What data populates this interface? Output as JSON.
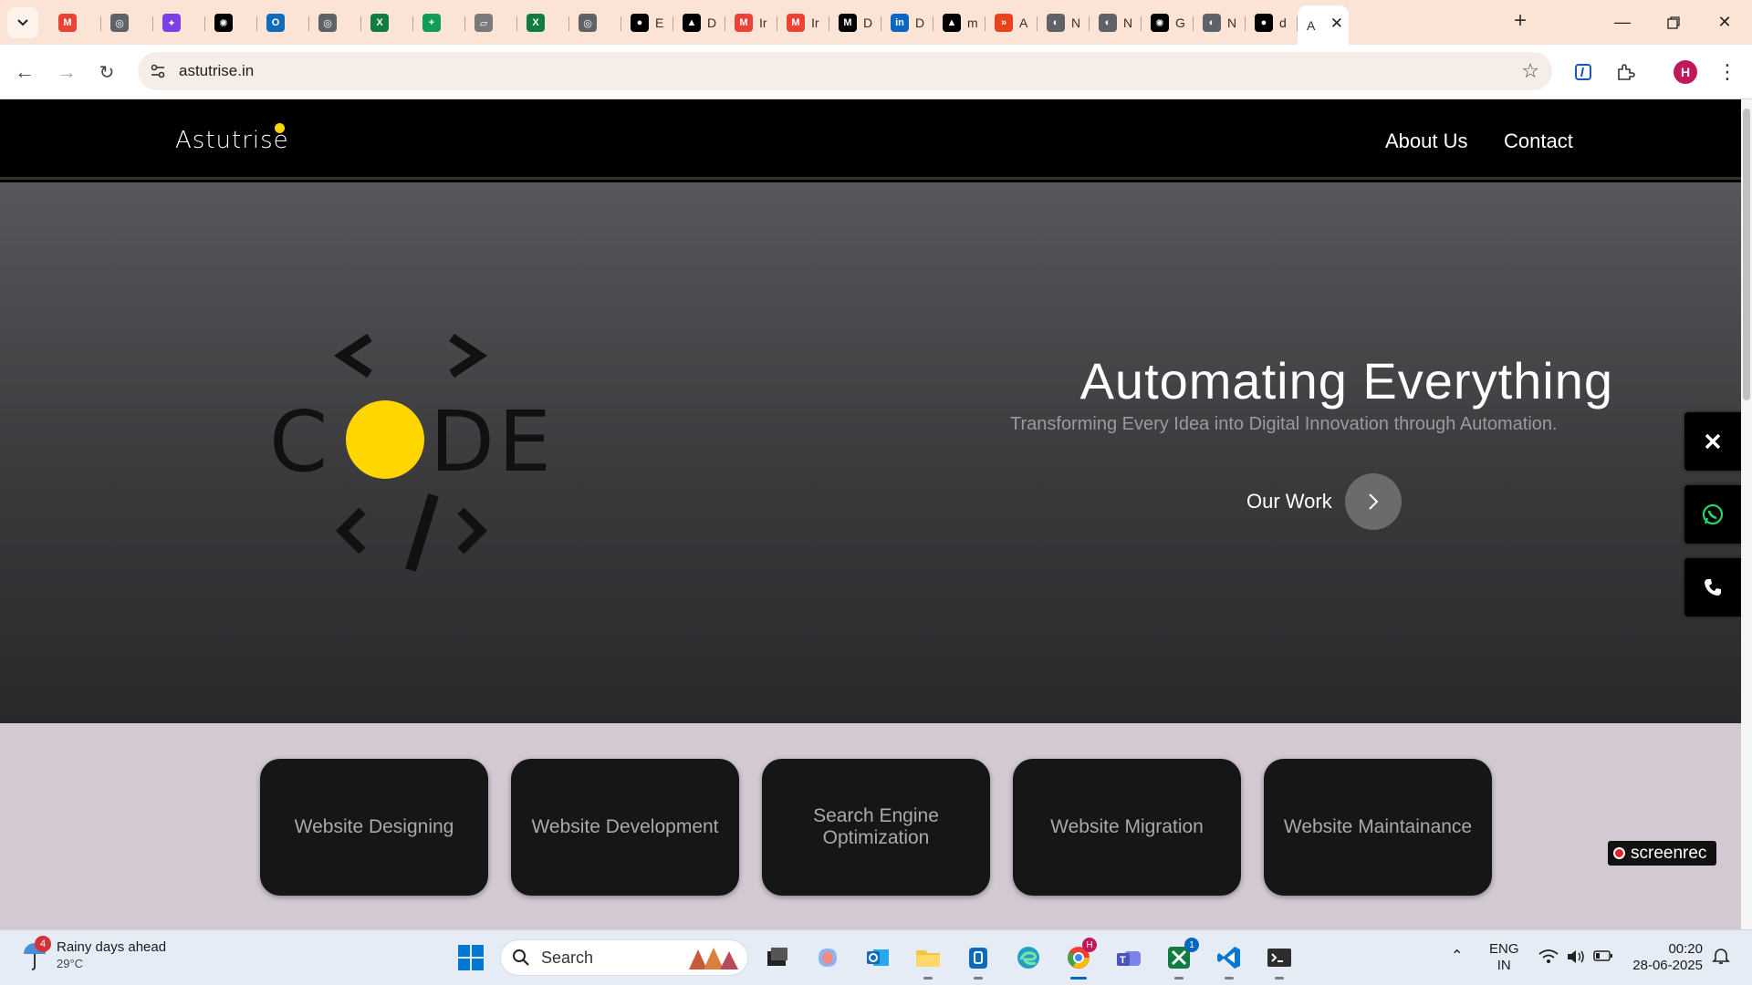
{
  "browser": {
    "tabs": [
      {
        "icon": "gmail-icon",
        "label": "",
        "color": "#ea4335"
      },
      {
        "icon": "globe-icon",
        "label": "",
        "color": "#5f6368"
      },
      {
        "icon": "copilot-icon",
        "label": "",
        "color": "#7b3fe4"
      },
      {
        "icon": "chatgpt-icon",
        "label": "",
        "color": "#000000"
      },
      {
        "icon": "outlook-icon",
        "label": "",
        "color": "#0f6cbd"
      },
      {
        "icon": "globe-icon",
        "label": "",
        "color": "#5f6368"
      },
      {
        "icon": "excel-icon",
        "label": "",
        "color": "#107c41"
      },
      {
        "icon": "sheets-plus-icon",
        "label": "",
        "color": "#0f9d58"
      },
      {
        "icon": "doc-icon",
        "label": "",
        "color": "#7a7a7a"
      },
      {
        "icon": "excel-icon",
        "label": "",
        "color": "#107c41"
      },
      {
        "icon": "globe-icon",
        "label": "",
        "color": "#5f6368"
      },
      {
        "icon": "github-icon",
        "label": "E",
        "color": "#000000"
      },
      {
        "icon": "vercel-icon",
        "label": "D",
        "color": "#000000"
      },
      {
        "icon": "gmail-icon",
        "label": "Ir",
        "color": "#ea4335"
      },
      {
        "icon": "gmail-icon",
        "label": "Ir",
        "color": "#ea4335"
      },
      {
        "icon": "medium-icon",
        "label": "D",
        "color": "#000000"
      },
      {
        "icon": "linkedin-icon",
        "label": "D",
        "color": "#0a66c2"
      },
      {
        "icon": "vercel-icon",
        "label": "m",
        "color": "#000000"
      },
      {
        "icon": "kaggle-icon",
        "label": "A",
        "color": "#e8431c"
      },
      {
        "icon": "netlify-icon",
        "label": "N",
        "color": "#5f6368"
      },
      {
        "icon": "netlify-icon",
        "label": "N",
        "color": "#5f6368"
      },
      {
        "icon": "chatgpt-icon",
        "label": "G",
        "color": "#000000"
      },
      {
        "icon": "netlify-icon",
        "label": "N",
        "color": "#5f6368"
      },
      {
        "icon": "github-icon",
        "label": "d",
        "color": "#000000"
      }
    ],
    "active_tab": {
      "label": "A"
    },
    "url": "astutrise.in"
  },
  "site": {
    "logo": "Astutrise",
    "nav": {
      "about": "About Us",
      "contact": "Contact"
    },
    "hero": {
      "title": "Automating Everything",
      "subtitle": "Transforming Every Idea into Digital Innovation through Automation.",
      "cta": "Our Work",
      "art_word": "CODE"
    },
    "services": [
      "Website Designing",
      "Website Development",
      "Search Engine Optimization",
      "Website Migration",
      "Website Maintainance"
    ],
    "watermark": "screenrec",
    "accent": "#ffd600"
  },
  "taskbar": {
    "weather_title": "Rainy days ahead",
    "weather_temp": "29°C",
    "weather_badge": "4",
    "search_label": "Search",
    "lang": "ENG",
    "region": "IN",
    "time": "00:20",
    "date": "28-06-2025",
    "chrome_badge": "H",
    "xbox_badge": "1"
  }
}
